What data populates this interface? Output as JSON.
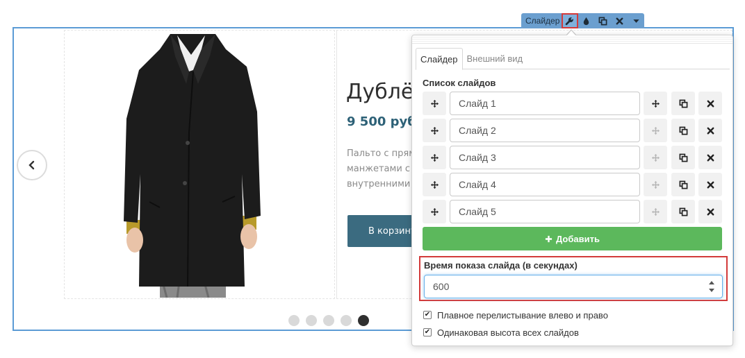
{
  "product": {
    "title": "Дублёнка",
    "price": "9 500 руб.",
    "description_lines": [
      "Пальто с прям",
      "манжетами с",
      "внутренними"
    ],
    "cart_label": "В корзину"
  },
  "slider_dots": {
    "count": 5,
    "active_index": 4
  },
  "toolbar": {
    "label": "Слайдер",
    "icons": [
      "wrench-icon",
      "drop-icon",
      "copy-icon",
      "close-icon",
      "caret-down-icon"
    ]
  },
  "panel": {
    "tabs": [
      {
        "label": "Слайдер",
        "active": true
      },
      {
        "label": "Внешний вид",
        "active": false
      }
    ],
    "slides_heading": "Список слайдов",
    "slides": [
      "Слайд 1",
      "Слайд 2",
      "Слайд 3",
      "Слайд 4",
      "Слайд 5"
    ],
    "add_label": "Добавить",
    "duration_label": "Время показа слайда (в секундах)",
    "duration_value": "600",
    "checkboxes": [
      {
        "label": "Плавное перелистывание влево и право",
        "checked": true
      },
      {
        "label": "Одинаковая высота всех слайдов",
        "checked": true
      }
    ]
  },
  "colors": {
    "accent_blue": "#5b9bd5",
    "price": "#2d6177",
    "cart_button": "#3b6b80",
    "add_button": "#5cb85c",
    "highlight": "#d33a3a"
  }
}
